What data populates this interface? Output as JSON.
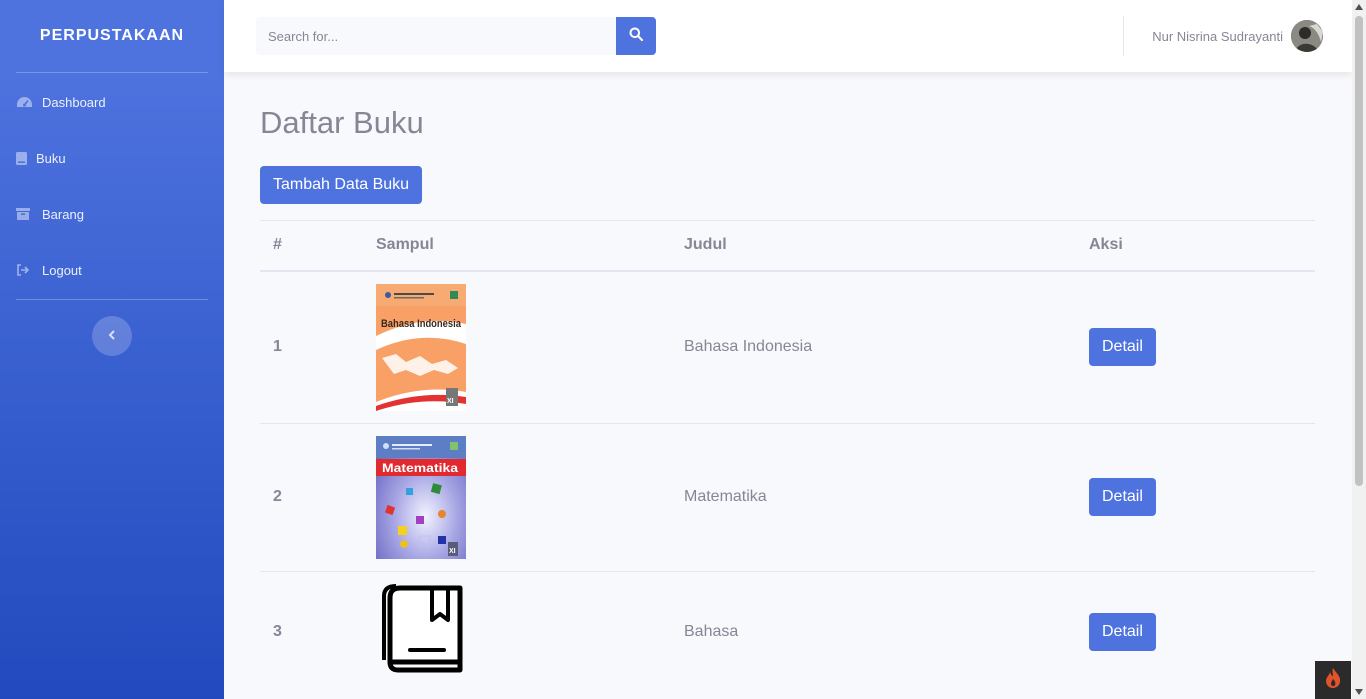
{
  "colors": {
    "primary": "#4e73df",
    "sidebar_end": "#224abe",
    "text_muted": "#858796"
  },
  "sidebar": {
    "brand": "PERPUSTAKAAN",
    "items": [
      {
        "label": "Dashboard",
        "icon": "tachometer-icon"
      },
      {
        "label": "Buku",
        "icon": "book-icon"
      },
      {
        "label": "Barang",
        "icon": "archive-icon"
      },
      {
        "label": "Logout",
        "icon": "sign-out-icon"
      }
    ],
    "toggle_icon": "chevron-left-icon"
  },
  "topbar": {
    "search_placeholder": "Search for...",
    "search_icon": "search-icon",
    "user_name": "Nur Nisrina Sudrayanti"
  },
  "main": {
    "title": "Daftar Buku",
    "add_button": "Tambah Data Buku",
    "table": {
      "headers": [
        "#",
        "Sampul",
        "Judul",
        "Aksi"
      ],
      "rows": [
        {
          "no": "1",
          "cover_text": "Bahasa Indonesia",
          "cover_grade": "XI",
          "title": "Bahasa Indonesia",
          "action": "Detail"
        },
        {
          "no": "2",
          "cover_text": "Matematika",
          "cover_grade": "XI",
          "title": "Matematika",
          "action": "Detail"
        },
        {
          "no": "3",
          "cover_text": "",
          "cover_grade": "",
          "title": "Bahasa",
          "action": "Detail"
        }
      ]
    }
  }
}
